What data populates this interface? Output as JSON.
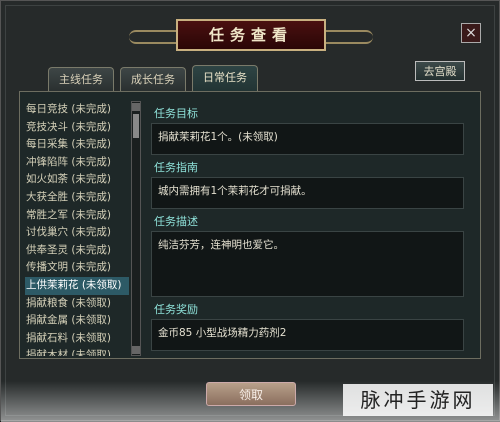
{
  "window": {
    "title": "任务查看",
    "close_glyph": "×"
  },
  "tabs": [
    {
      "label": "主线任务"
    },
    {
      "label": "成长任务"
    },
    {
      "label": "日常任务"
    }
  ],
  "go_button": "去宫殿",
  "quest_list": [
    "每日竞技 (未完成)",
    "竞技决斗 (未完成)",
    "每日采集 (未完成)",
    "冲锋陷阵 (未完成)",
    "如火如荼 (未完成)",
    "大获全胜 (未完成)",
    "常胜之军 (未完成)",
    "讨伐巢穴 (未完成)",
    "供奉圣灵 (未完成)",
    "传播文明 (未完成)",
    "上供茉莉花 (未领取)",
    "捐献粮食 (未领取)",
    "捐献金属 (未领取)",
    "捐献石料 (未领取)",
    "捐献木材 (未领取)"
  ],
  "selected_index": 10,
  "detail": {
    "goal_label": "任务目标",
    "goal_text": "捐献茉莉花1个。(未领取)",
    "guide_label": "任务指南",
    "guide_text": "城内需拥有1个茉莉花才可捐献。",
    "desc_label": "任务描述",
    "desc_text": "纯洁芬芳，连神明也爱它。",
    "reward_label": "任务奖励",
    "reward_text": "金币85   小型战场精力药剂2"
  },
  "accept_button": "领取",
  "watermark": "脉冲手游网"
}
